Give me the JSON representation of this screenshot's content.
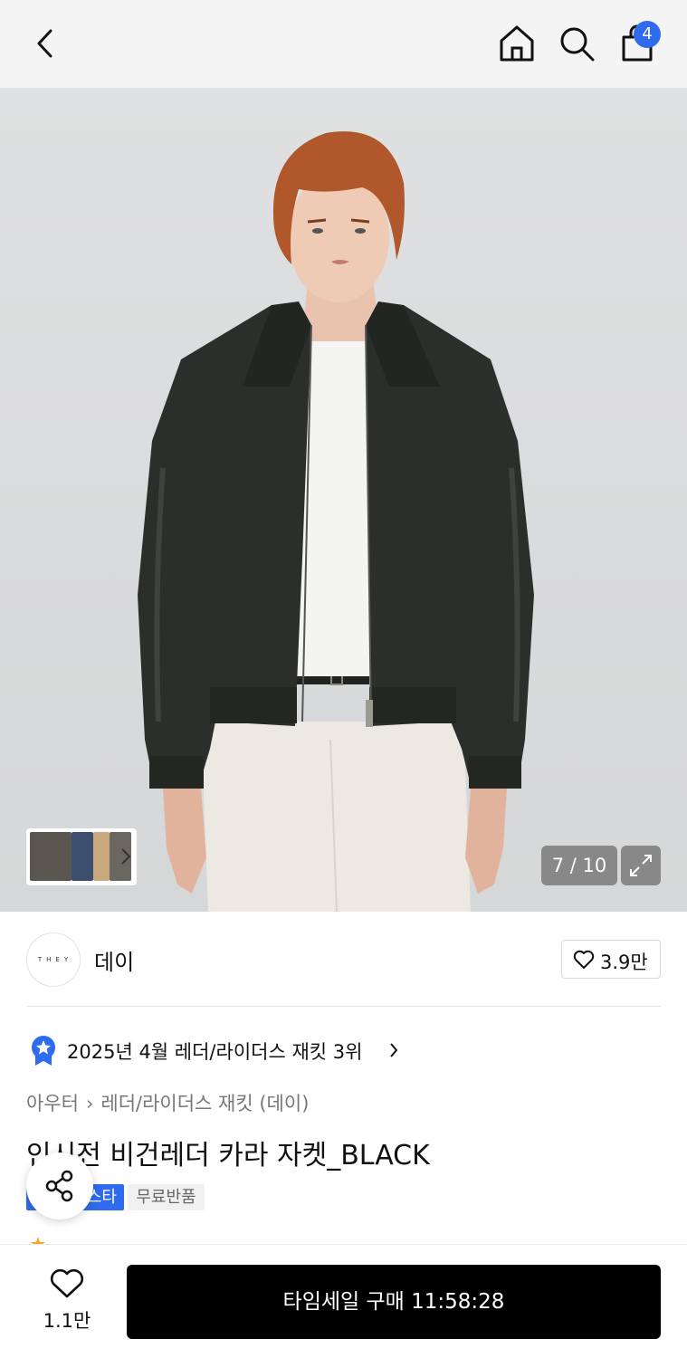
{
  "header": {
    "back_icon": "chevron-left-icon",
    "home_icon": "home-icon",
    "search_icon": "search-icon",
    "cart_icon": "shopping-bag-icon",
    "cart_count": "4",
    "badge_color": "#2f6bef"
  },
  "gallery": {
    "counter": "7 / 10",
    "expand_icon": "expand-icon",
    "thumbs_chevron_icon": "chevron-right-icon"
  },
  "brand": {
    "logo_text": "THEY",
    "name": "데이",
    "likes": "3.9만"
  },
  "ranking": {
    "text": "2025년 4월 레더/라이더스 재킷 3위"
  },
  "breadcrumb": {
    "category": "아우터",
    "subcategory": "레더/라이더스 재킷 (데이)"
  },
  "product": {
    "title": "인시전 비건레더 카라 자켓_BLACK",
    "tag_blue": "스타",
    "tag_gray": "무료반품"
  },
  "bottom_bar": {
    "wish_count": "1.1만",
    "buy_label": "타임세일 구매 11:58:28"
  }
}
